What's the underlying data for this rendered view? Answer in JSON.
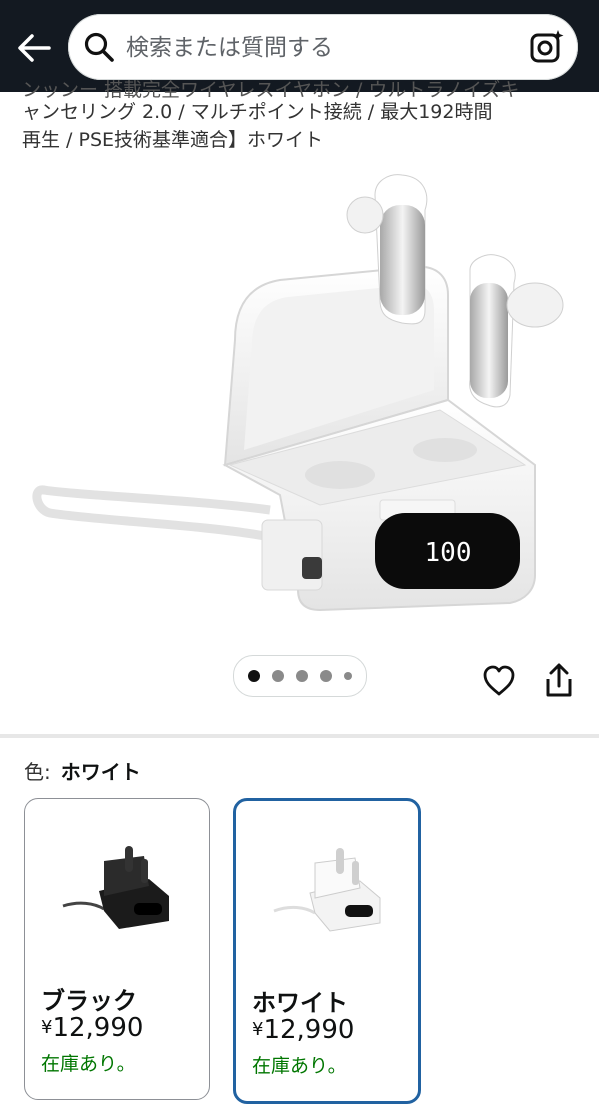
{
  "header": {
    "search_placeholder": "検索または質問する"
  },
  "product": {
    "title_clipped": "ンッンー 搭載完全ワイヤレスイヤホン / ウルトラノイズキ",
    "title_line2": "ャンセリング 2.0 / マルチポイント接続 / 最大192時間",
    "title_line3": "再生 / PSE技術基準適合】ホワイト",
    "case_display": "100"
  },
  "carousel": {
    "active_index": 0,
    "dot_count": 5
  },
  "color": {
    "label": "色:",
    "selected": "ホワイト"
  },
  "swatches": [
    {
      "name": "ブラック",
      "currency": "¥",
      "price": "12,990",
      "stock": "在庫あり。"
    },
    {
      "name": "ホワイト",
      "currency": "¥",
      "price": "12,990",
      "stock": "在庫あり。"
    }
  ],
  "colors": {
    "header_bg": "#131921",
    "selected_border": "#2162a1",
    "stock_green": "#007600"
  }
}
